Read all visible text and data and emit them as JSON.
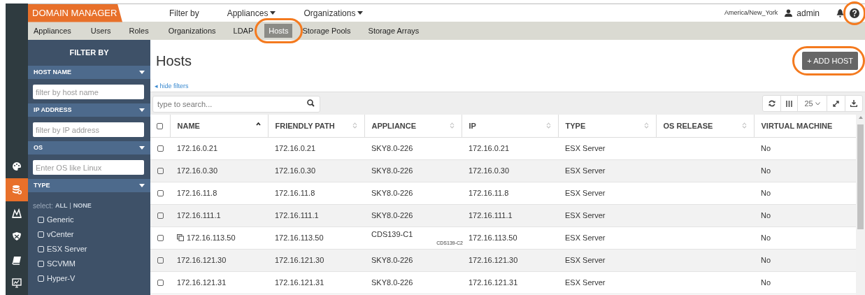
{
  "header": {
    "logo": "DOMAIN MANAGER",
    "menus": [
      {
        "label": "Filter by",
        "dropdown": false
      },
      {
        "label": "Appliances",
        "dropdown": true
      },
      {
        "label": "Organizations",
        "dropdown": true
      }
    ],
    "timezone": "America/New_York",
    "user": "admin",
    "help_circled": true
  },
  "tabs": [
    {
      "label": "Appliances",
      "selected": false,
      "circled": false
    },
    {
      "label": "Users",
      "selected": false,
      "circled": false
    },
    {
      "label": "Roles",
      "selected": false,
      "circled": false
    },
    {
      "label": "Organizations",
      "selected": false,
      "circled": false
    },
    {
      "label": "LDAP",
      "selected": false,
      "circled": false
    },
    {
      "label": "Hosts",
      "selected": true,
      "circled": true
    },
    {
      "label": "Storage Pools",
      "selected": false,
      "circled": false
    },
    {
      "label": "Storage Arrays",
      "selected": false,
      "circled": false
    }
  ],
  "rail": [
    {
      "selected": false
    },
    {
      "selected": true
    },
    {
      "selected": false
    },
    {
      "selected": false
    },
    {
      "selected": false
    },
    {
      "selected": false
    }
  ],
  "sidebar": {
    "title": "FILTER BY",
    "sections": [
      {
        "title": "HOST NAME",
        "kind": "input",
        "placeholder": "filter by host name"
      },
      {
        "title": "IP ADDRESS",
        "kind": "input",
        "placeholder": "filter by IP address"
      },
      {
        "title": "OS",
        "kind": "input",
        "placeholder": "Enter OS like Linux"
      },
      {
        "title": "TYPE",
        "kind": "checklist",
        "select_label": "select:",
        "select_all": "ALL",
        "select_separator": "|",
        "select_none": "NONE",
        "options": [
          {
            "label": "Generic",
            "checked": false
          },
          {
            "label": "vCenter",
            "checked": false
          },
          {
            "label": "ESX Server",
            "checked": false
          },
          {
            "label": "SCVMM",
            "checked": false
          },
          {
            "label": "Hyper-V",
            "checked": false
          }
        ]
      }
    ]
  },
  "page": {
    "title": "Hosts",
    "add_button": "+ ADD HOST",
    "add_circled": true,
    "hide_filters": "◂ hide filters",
    "search_placeholder": "type to search...",
    "page_size": "25"
  },
  "table": {
    "all_checked": false,
    "columns": [
      {
        "label": "NAME",
        "sortable": true,
        "sorted": true
      },
      {
        "label": "FRIENDLY PATH",
        "sortable": true,
        "sorted": false
      },
      {
        "label": "APPLIANCE",
        "sortable": true,
        "sorted": false
      },
      {
        "label": "IP",
        "sortable": true,
        "sorted": false
      },
      {
        "label": "TYPE",
        "sortable": true,
        "sorted": false
      },
      {
        "label": "OS RELEASE",
        "sortable": true,
        "sorted": false
      },
      {
        "label": "VIRTUAL MACHINE",
        "sortable": false
      }
    ],
    "rows": [
      {
        "checked": false,
        "cluster": false,
        "cells": [
          "172.16.0.21",
          "172.16.0.21",
          "SKY8.0-226",
          "172.16.0.21",
          "ESX Server",
          "",
          "No"
        ]
      },
      {
        "checked": false,
        "cluster": false,
        "cells": [
          "172.16.0.30",
          "172.16.0.30",
          "SKY8.0-226",
          "172.16.0.30",
          "ESX Server",
          "",
          "No"
        ]
      },
      {
        "checked": false,
        "cluster": false,
        "cells": [
          "172.16.11.8",
          "172.16.11.8",
          "SKY8.0-226",
          "172.16.11.8",
          "ESX Server",
          "",
          "No"
        ]
      },
      {
        "checked": false,
        "cluster": false,
        "cells": [
          "172.16.111.1",
          "172.16.111.1",
          "SKY8.0-226",
          "172.16.111.1",
          "ESX Server",
          "",
          "No"
        ]
      },
      {
        "checked": false,
        "cluster": true,
        "cells": [
          "172.16.113.50",
          "172.16.113.50",
          "CDS139-C1",
          "172.16.113.50",
          "ESX Server",
          "",
          "No"
        ],
        "appliance_extra": "CDS139-C2"
      },
      {
        "checked": false,
        "cluster": false,
        "cells": [
          "172.16.121.30",
          "172.16.121.30",
          "SKY8.0-226",
          "172.16.121.30",
          "ESX Server",
          "",
          "No"
        ]
      },
      {
        "checked": false,
        "cluster": false,
        "cells": [
          "172.16.121.31",
          "172.16.121.31",
          "SKY8.0-226",
          "172.16.121.31",
          "ESX Server",
          "",
          "No"
        ]
      }
    ]
  }
}
